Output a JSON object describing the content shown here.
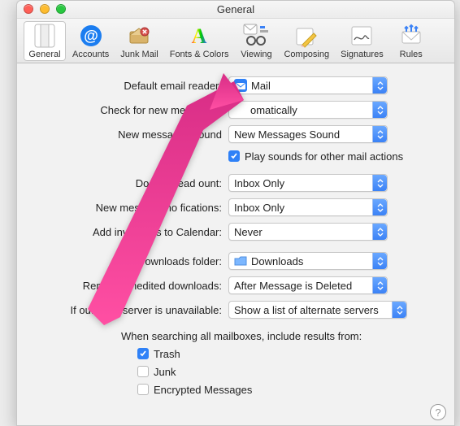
{
  "window": {
    "title": "General"
  },
  "toolbar": {
    "items": [
      {
        "name": "general",
        "label": "General"
      },
      {
        "name": "accounts",
        "label": "Accounts"
      },
      {
        "name": "junk",
        "label": "Junk Mail"
      },
      {
        "name": "fonts",
        "label": "Fonts & Colors"
      },
      {
        "name": "viewing",
        "label": "Viewing"
      },
      {
        "name": "composing",
        "label": "Composing"
      },
      {
        "name": "signatures",
        "label": "Signatures"
      },
      {
        "name": "rules",
        "label": "Rules"
      }
    ]
  },
  "settings": {
    "default_reader": {
      "label": "Default email reader:",
      "value": "Mail"
    },
    "check_messages": {
      "label": "Check for new messages:",
      "value": "omatically"
    },
    "new_sound": {
      "label": "New messages sound",
      "value": "New Messages Sound"
    },
    "play_sounds": {
      "label": "Play sounds for other mail actions"
    },
    "dock_unread": {
      "label": "Dock unread  ount:",
      "value": "Inbox Only"
    },
    "new_notifications": {
      "label": "New message no  fications:",
      "value": "Inbox Only"
    },
    "add_to_calendar": {
      "label": "Add invitations to Calendar:",
      "value": "Never"
    },
    "downloads_folder": {
      "label": "Downloads folder:",
      "value": "Downloads"
    },
    "remove_downloads": {
      "label": "Remove unedited downloads:",
      "value": "After Message is Deleted"
    },
    "outgoing_unavail": {
      "label": "If outgoing server is unavailable:",
      "value": "Show a list of alternate servers"
    },
    "search_heading": "When searching all mailboxes, include results from:",
    "search_trash": {
      "label": "Trash"
    },
    "search_junk": {
      "label": "Junk"
    },
    "search_encrypted": {
      "label": "Encrypted Messages"
    }
  }
}
